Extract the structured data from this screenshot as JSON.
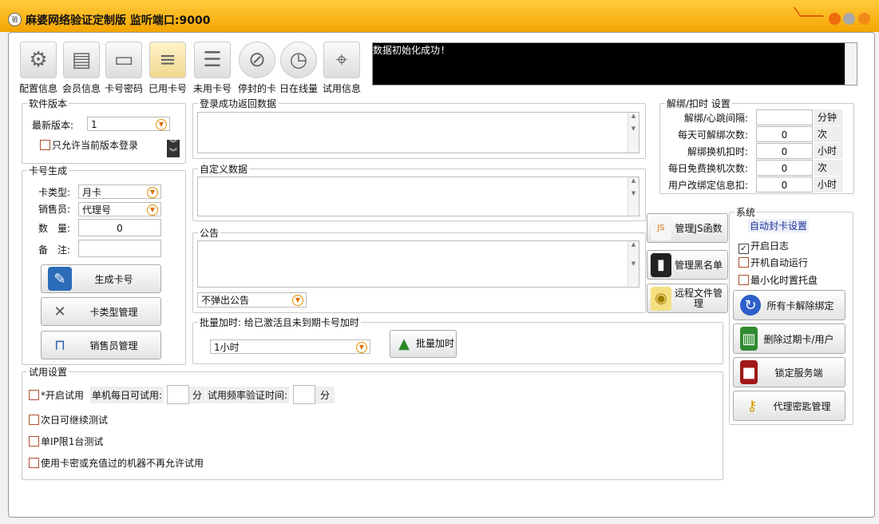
{
  "window": {
    "title": "麻婆网络验证定制版  监听端口:9000",
    "app_icon_text": "验",
    "btn_colors": [
      "#f06a10",
      "#a8a8a8",
      "#f08a18"
    ]
  },
  "toolbar": [
    {
      "label": "配置信息",
      "icon": "gear-icon"
    },
    {
      "label": "会员信息",
      "icon": "member-card-icon"
    },
    {
      "label": "卡号密码",
      "icon": "card-icon"
    },
    {
      "label": "已用卡号",
      "icon": "notepad-icon"
    },
    {
      "label": "未用卡号",
      "icon": "document-icon"
    },
    {
      "label": "停封的卡",
      "icon": "compass-icon"
    },
    {
      "label": "日在线量",
      "icon": "clock-icon"
    },
    {
      "label": "试用信息",
      "icon": "map-pin-icon"
    }
  ],
  "log": {
    "text": "数据初始化成功!"
  },
  "version": {
    "legend": "软件版本",
    "latest_label": "最新版本:",
    "latest_value": "1",
    "only_current_label": "只允许当前版本登录"
  },
  "cardgen": {
    "legend": "卡号生成",
    "type_label": "卡类型:",
    "type_value": "月卡",
    "seller_label": "销售员:",
    "seller_value": "代理号",
    "qty_label": "数　量:",
    "qty_value": "0",
    "note_label": "备　注:",
    "note_value": "",
    "gen_button": "生成卡号",
    "type_mgmt_button": "卡类型管理",
    "seller_mgmt_button": "销售员管理"
  },
  "login_return": {
    "legend": "登录成功返回数据"
  },
  "custom_data": {
    "legend": "自定义数据"
  },
  "notice": {
    "legend": "公告",
    "popup_value": "不弹出公告"
  },
  "mid_buttons": {
    "js": "管理JS函数",
    "blacklist": "管理黑名单",
    "remote": "远程文件管理"
  },
  "batch": {
    "legend": "批量加时:  给已激活且未到期卡号加时",
    "duration_value": "1小时",
    "button": "批量加时"
  },
  "unbind": {
    "legend": "解绑/扣时 设置",
    "rows": [
      {
        "label": "解绑/心跳间隔:",
        "value": "",
        "unit": "分钟"
      },
      {
        "label": "每天可解绑次数:",
        "value": "0",
        "unit": "次"
      },
      {
        "label": "解绑换机扣时:",
        "value": "0",
        "unit": "小时"
      },
      {
        "label": "每日免费换机次数:",
        "value": "0",
        "unit": "次"
      },
      {
        "label": "用户改绑定信息扣:",
        "value": "0",
        "unit": "小时"
      }
    ]
  },
  "system": {
    "legend": "系统",
    "auto_ban_link": "自动封卡设置",
    "enable_log": "开启日志",
    "enable_log_checked": true,
    "autostart": "开机自动运行",
    "tray": "最小化时置托盘",
    "unbind_all": "所有卡解除绑定",
    "delete_expired": "删除过期卡/用户",
    "lock_server": "锁定服务端",
    "agent_key": "代理密匙管理"
  },
  "trial": {
    "legend": "试用设置",
    "enable_label": "*开启试用",
    "per_day_label": "单机每日可试用:",
    "per_day_value": "",
    "per_day_unit": "分",
    "freq_label": "试用频率验证时间:",
    "freq_value": "",
    "freq_unit": "分",
    "next_day": "次日可继续测试",
    "single_ip": "单IP限1台测试",
    "no_retry": "使用卡密或充值过的机器不再允许试用"
  }
}
